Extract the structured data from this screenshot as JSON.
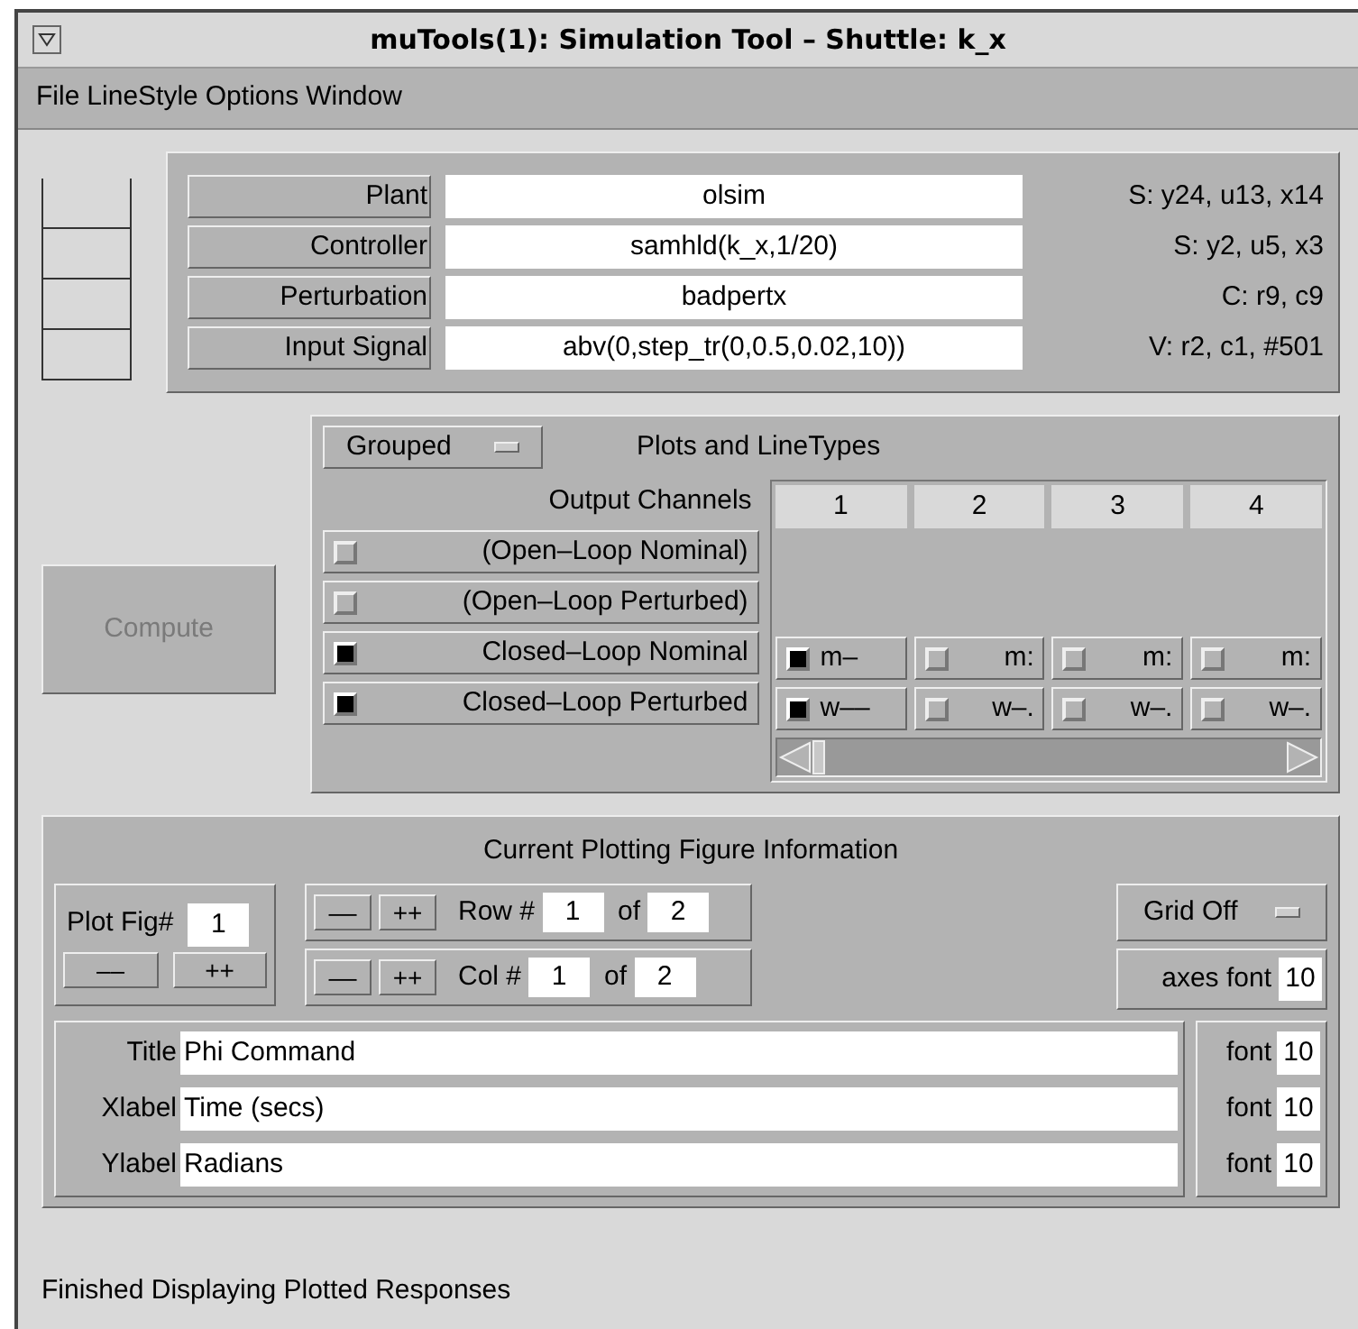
{
  "window": {
    "title": "muTools(1): Simulation Tool –  Shuttle: k_x"
  },
  "menu": [
    "File",
    "LineStyle",
    "Options",
    "Window"
  ],
  "inputs": [
    {
      "label": "Plant",
      "value": "olsim",
      "info": "S: y24,  u13,  x14"
    },
    {
      "label": "Controller",
      "value": "samhld(k_x,1/20)",
      "info": "S: y2,  u5,  x3"
    },
    {
      "label": "Perturbation",
      "value": "badpertx",
      "info": "C: r9,  c9"
    },
    {
      "label": "Input Signal",
      "value": "abv(0,step_tr(0,0.5,0.02,10))",
      "info": "V: r2,  c1,  #501"
    }
  ],
  "compute_button": {
    "label": "Compute",
    "disabled": true
  },
  "plots": {
    "mode": "Grouped",
    "title": "Plots and LineTypes",
    "header": "Output Channels",
    "columns": [
      "1",
      "2",
      "3",
      "4"
    ],
    "rows": [
      {
        "label": "(Open–Loop Nominal)",
        "checked": false,
        "cells": []
      },
      {
        "label": "(Open–Loop Perturbed)",
        "checked": false,
        "cells": []
      },
      {
        "label": "Closed–Loop Nominal",
        "checked": true,
        "cells": [
          {
            "label": "m–",
            "checked": true
          },
          {
            "label": "m:",
            "checked": false
          },
          {
            "label": "m:",
            "checked": false
          },
          {
            "label": "m:",
            "checked": false
          }
        ]
      },
      {
        "label": "Closed–Loop Perturbed",
        "checked": true,
        "cells": [
          {
            "label": "w––",
            "checked": true
          },
          {
            "label": "w–.",
            "checked": false
          },
          {
            "label": "w–.",
            "checked": false
          },
          {
            "label": "w–.",
            "checked": false
          }
        ]
      }
    ]
  },
  "figure": {
    "title": "Current Plotting Figure Information",
    "plot_fig_label": "Plot Fig#",
    "plot_fig": "1",
    "dec": "––",
    "inc": "++",
    "nav": [
      {
        "dec": "––",
        "inc": "++",
        "label": "Row #",
        "value": "1",
        "of": "of",
        "total": "2"
      },
      {
        "dec": "––",
        "inc": "++",
        "label": "Col #",
        "value": "1",
        "of": "of",
        "total": "2"
      }
    ],
    "grid": "Grid Off",
    "axes_font_label": "axes font",
    "axes_font": "10",
    "labels": [
      {
        "label": "Title",
        "value": "Phi Command",
        "font_label": "font",
        "font": "10"
      },
      {
        "label": "Xlabel",
        "value": "Time (secs)",
        "font_label": "font",
        "font": "10"
      },
      {
        "label": "Ylabel",
        "value": "Radians",
        "font_label": "font",
        "font": "10"
      }
    ]
  },
  "status": "Finished Displaying Plotted Responses"
}
